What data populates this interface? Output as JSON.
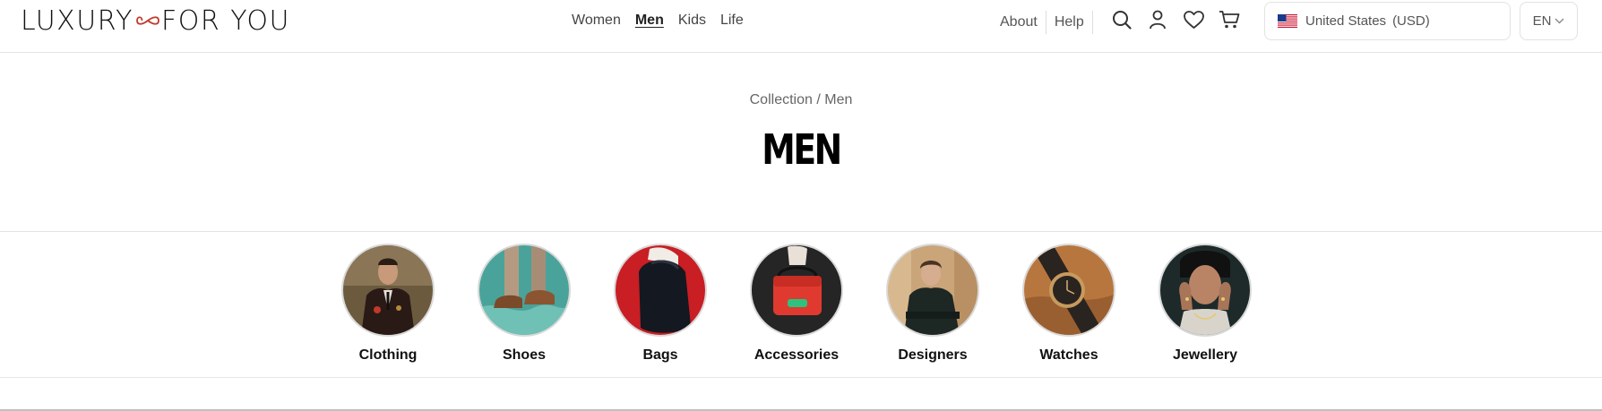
{
  "brand": {
    "logo_left": "LUXURY",
    "logo_right": "FOR YOU",
    "accent": "#c0392b"
  },
  "nav": {
    "items": [
      {
        "label": "Women",
        "active": false
      },
      {
        "label": "Men",
        "active": true
      },
      {
        "label": "Kids",
        "active": false
      },
      {
        "label": "Life",
        "active": false
      }
    ]
  },
  "utility": {
    "about": "About",
    "help": "Help"
  },
  "icons": [
    "search-icon",
    "user-icon",
    "heart-icon",
    "cart-icon"
  ],
  "region": {
    "country": "United States",
    "currency": "(USD)",
    "language": "EN"
  },
  "breadcrumb": {
    "root": "Collection",
    "separator": "/",
    "current": "Men"
  },
  "page": {
    "title": "MEN"
  },
  "categories": [
    {
      "label": "Clothing",
      "bg": "#6b5a3d"
    },
    {
      "label": "Shoes",
      "bg": "#4aa39a"
    },
    {
      "label": "Bags",
      "bg": "#c81e24"
    },
    {
      "label": "Accessories",
      "bg": "#222222"
    },
    {
      "label": "Designers",
      "bg": "#caa57a"
    },
    {
      "label": "Watches",
      "bg": "#b8763f"
    },
    {
      "label": "Jewellery",
      "bg": "#1e2a2a"
    }
  ]
}
